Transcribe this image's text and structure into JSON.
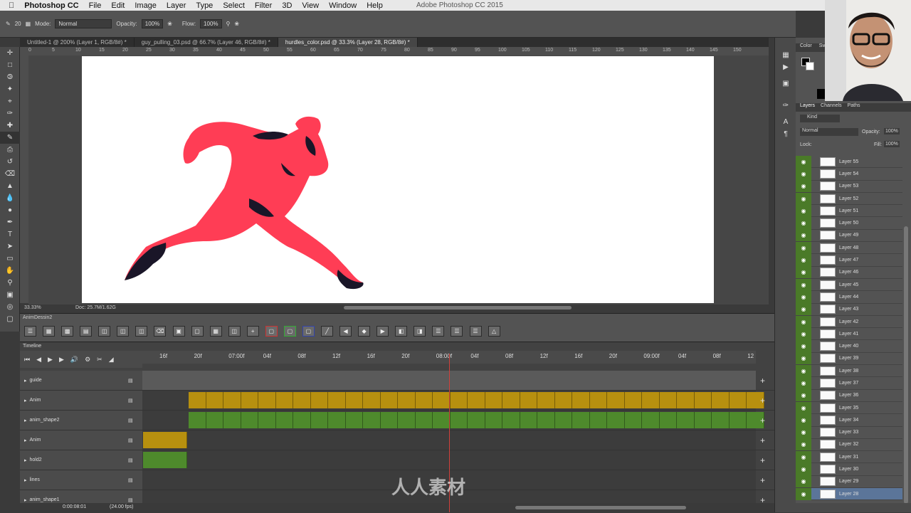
{
  "menubar": {
    "app": "Photoshop CC",
    "items": [
      "File",
      "Edit",
      "Image",
      "Layer",
      "Type",
      "Select",
      "Filter",
      "3D",
      "View",
      "Window",
      "Help"
    ],
    "title": "Adobe Photoshop CC 2015"
  },
  "options": {
    "brush_size": "20",
    "mode_label": "Mode:",
    "mode_value": "Normal",
    "opacity_label": "Opacity:",
    "opacity_value": "100%",
    "flow_label": "Flow:",
    "flow_value": "100%"
  },
  "doc_tabs": [
    "Untitled-1 @ 200% (Layer 1, RGB/8#) *",
    "guy_pulling_03.psd @ 66.7% (Layer 46, RGB/8#) *",
    "hurdles_color.psd @ 33.3% (Layer 28, RGB/8#) *"
  ],
  "ruler_ticks": [
    "0",
    "5",
    "10",
    "15",
    "20",
    "25",
    "30",
    "35",
    "40",
    "45",
    "50",
    "55",
    "60",
    "65",
    "70",
    "75",
    "80",
    "85",
    "90",
    "95",
    "100",
    "105",
    "110",
    "115",
    "120",
    "125",
    "130",
    "135",
    "140",
    "145",
    "150"
  ],
  "status": {
    "zoom": "33.33%",
    "doc": "Doc: 25.7M/1.62G"
  },
  "anim_panel": {
    "title": "AnimDessin2"
  },
  "timeline": {
    "title": "Timeline",
    "ruler": [
      "16f",
      "20f",
      "07:00f",
      "04f",
      "08f",
      "12f",
      "16f",
      "20f",
      "08:00f",
      "04f",
      "08f",
      "12f",
      "16f",
      "20f",
      "09:00f",
      "04f",
      "08f",
      "12"
    ],
    "tracks": [
      "guide",
      "Anim",
      "anim_shape2",
      "Anim",
      "hold2",
      "lines",
      "anim_shape1"
    ],
    "current_time": "0:00:08:01",
    "fps": "(24.00 fps)"
  },
  "right_panel": {
    "color_tab": "Color",
    "sw_tab": "Sw",
    "layer_tabs": [
      "Layers",
      "Channels",
      "Paths"
    ],
    "kind_label": "Kind",
    "blend": "Normal",
    "opacity_label": "Opacity:",
    "opacity_value": "100%",
    "lock_label": "Lock:",
    "fill_label": "Fill:",
    "fill_value": "100%",
    "layers": [
      "Layer 55",
      "Layer 54",
      "Layer 53",
      "Layer 52",
      "Layer 51",
      "Layer 50",
      "Layer 49",
      "Layer 48",
      "Layer 47",
      "Layer 46",
      "Layer 45",
      "Layer 44",
      "Layer 43",
      "Layer 42",
      "Layer 41",
      "Layer 40",
      "Layer 39",
      "Layer 38",
      "Layer 37",
      "Layer 36",
      "Layer 35",
      "Layer 34",
      "Layer 33",
      "Layer 32",
      "Layer 31",
      "Layer 30",
      "Layer 29",
      "Layer 28"
    ],
    "selected_layer": "Layer 28"
  },
  "watermark": "人人素材",
  "colors": {
    "anim_orange": "#b7900f",
    "anim_green": "#4e8a2c",
    "figure_red": "#ff3d55"
  }
}
